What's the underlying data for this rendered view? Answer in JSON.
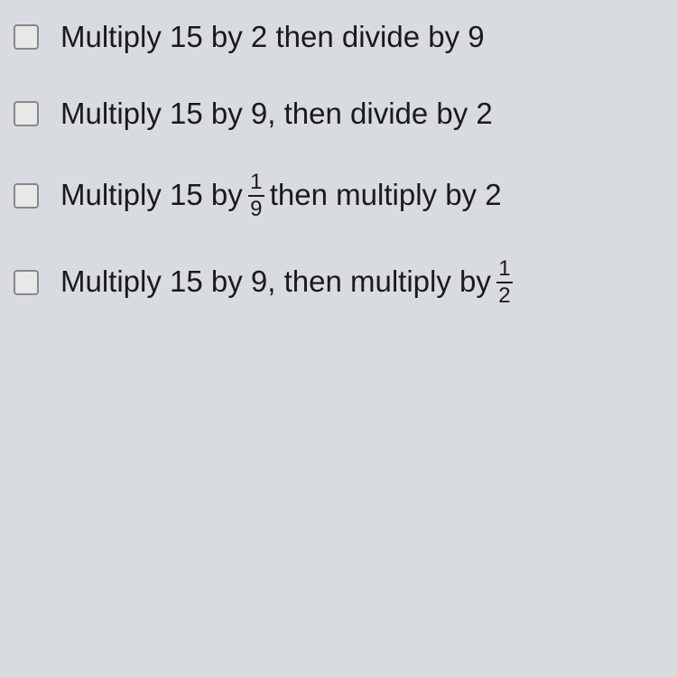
{
  "options": [
    {
      "pre": "Multiply 15 by 2 then divide by 9",
      "frac_num": "",
      "frac_den": "",
      "post": ""
    },
    {
      "pre": "Multiply 15 by 9, then divide by 2",
      "frac_num": "",
      "frac_den": "",
      "post": ""
    },
    {
      "pre": "Multiply 15 by ",
      "frac_num": "1",
      "frac_den": "9",
      "post": " then multiply by 2"
    },
    {
      "pre": "Multiply 15 by 9, then multiply by ",
      "frac_num": "1",
      "frac_den": "2",
      "post": ""
    }
  ]
}
